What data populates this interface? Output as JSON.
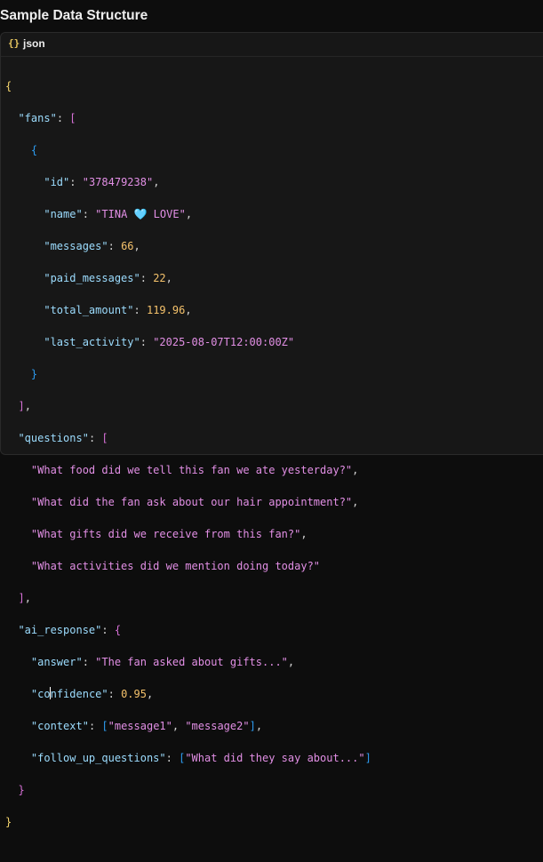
{
  "header": {
    "title": "Sample Data Structure"
  },
  "code_block": {
    "language_icon": "{}",
    "language": "json",
    "fans_key": "\"fans\"",
    "fan": {
      "id_key": "\"id\"",
      "id": "\"378479238\"",
      "name_key": "\"name\"",
      "name": "\"TINA 🩵 LOVE\"",
      "messages_key": "\"messages\"",
      "messages": "66",
      "paid_messages_key": "\"paid_messages\"",
      "paid_messages": "22",
      "total_amount_key": "\"total_amount\"",
      "total_amount": "119.96",
      "last_activity_key": "\"last_activity\"",
      "last_activity": "\"2025-08-07T12:00:00Z\""
    },
    "questions_key": "\"questions\"",
    "questions": [
      "\"What food did we tell this fan we ate yesterday?\"",
      "\"What did the fan ask about our hair appointment?\"",
      "\"What gifts did we receive from this fan?\"",
      "\"What activities did we mention doing today?\""
    ],
    "ai_response_key": "\"ai_response\"",
    "ai_response": {
      "answer_key": "\"answer\"",
      "answer": "\"The fan asked about gifts...\"",
      "confidence_key_a": "\"co",
      "confidence_key_b": "nfidence\"",
      "confidence": "0.95",
      "context_key": "\"context\"",
      "context": [
        "\"message1\"",
        "\"message2\""
      ],
      "follow_up_key": "\"follow_up_questions\"",
      "follow_up": [
        "\"What did they say about...\""
      ]
    }
  },
  "colors": {
    "background": "#0d0d0d",
    "panel": "#171717",
    "key": "#9cdcfe",
    "string": "#e28fe5",
    "number": "#f5c26b",
    "brace": "#f5d56d",
    "bracket_magenta": "#d670d6",
    "bracket_blue": "#2d9cf0"
  }
}
